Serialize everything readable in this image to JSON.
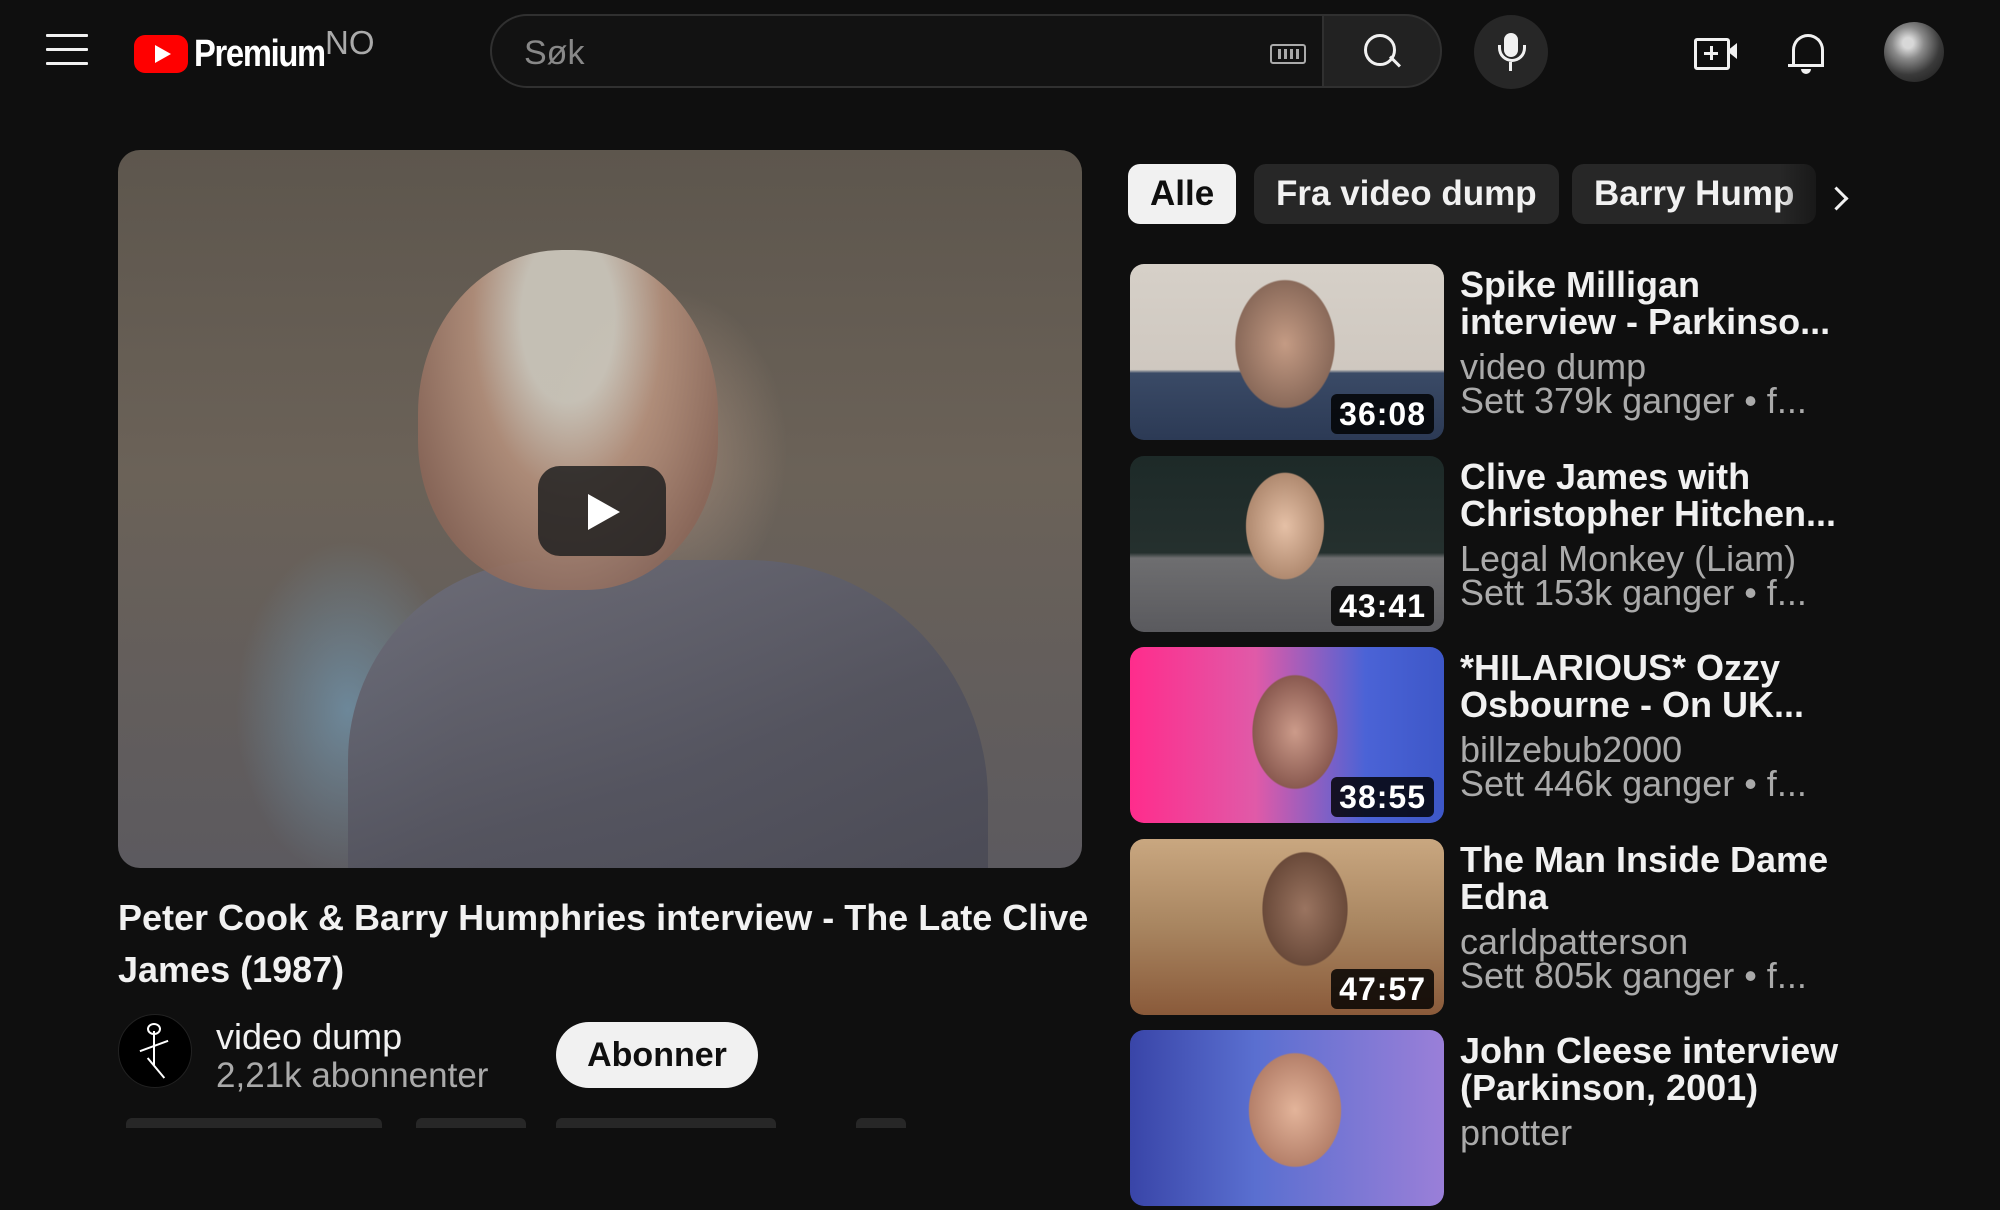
{
  "header": {
    "logo_text": "Premium",
    "country_code": "NO",
    "search_placeholder": "Søk"
  },
  "video": {
    "title": "Peter Cook & Barry Humphries interview - The Late Clive James (1987)",
    "channel_name": "video dump",
    "subscribers": "2,21k abonnenter",
    "subscribe_label": "Abonner"
  },
  "chips": [
    "Alle",
    "Fra video dump",
    "Barry Hump"
  ],
  "recommendations": [
    {
      "title": "Spike Milligan interview - Parkinso...",
      "channel": "video dump",
      "views": "Sett 379k ganger",
      "meta_suffix": " • f...",
      "duration": "36:08"
    },
    {
      "title": "Clive James with Christopher Hitchen...",
      "channel": "Legal Monkey (Liam)",
      "views": "Sett 153k ganger",
      "meta_suffix": " • f...",
      "duration": "43:41"
    },
    {
      "title": "*HILARIOUS* Ozzy Osbourne - On UK...",
      "channel": "billzebub2000",
      "views": "Sett 446k ganger",
      "meta_suffix": " • f...",
      "duration": "38:55"
    },
    {
      "title": "The Man Inside Dame Edna",
      "channel": "carldpatterson",
      "views": "Sett 805k ganger",
      "meta_suffix": " • f...",
      "duration": "47:57"
    },
    {
      "title": "John Cleese interview (Parkinson, 2001)",
      "channel": "pnotter",
      "views": "",
      "meta_suffix": "",
      "duration": ""
    }
  ],
  "colors": {
    "background": "#0f0f0f",
    "brand_red": "#ff0000",
    "primary_text": "#f1f1f1",
    "secondary_text": "#aaaaaa",
    "chip_bg": "#272727"
  },
  "icons": [
    "menu-icon",
    "youtube-logo-icon",
    "keyboard-icon",
    "search-icon",
    "mic-icon",
    "create-video-icon",
    "bell-icon",
    "profile-avatar",
    "play-icon",
    "chevron-right-icon"
  ]
}
